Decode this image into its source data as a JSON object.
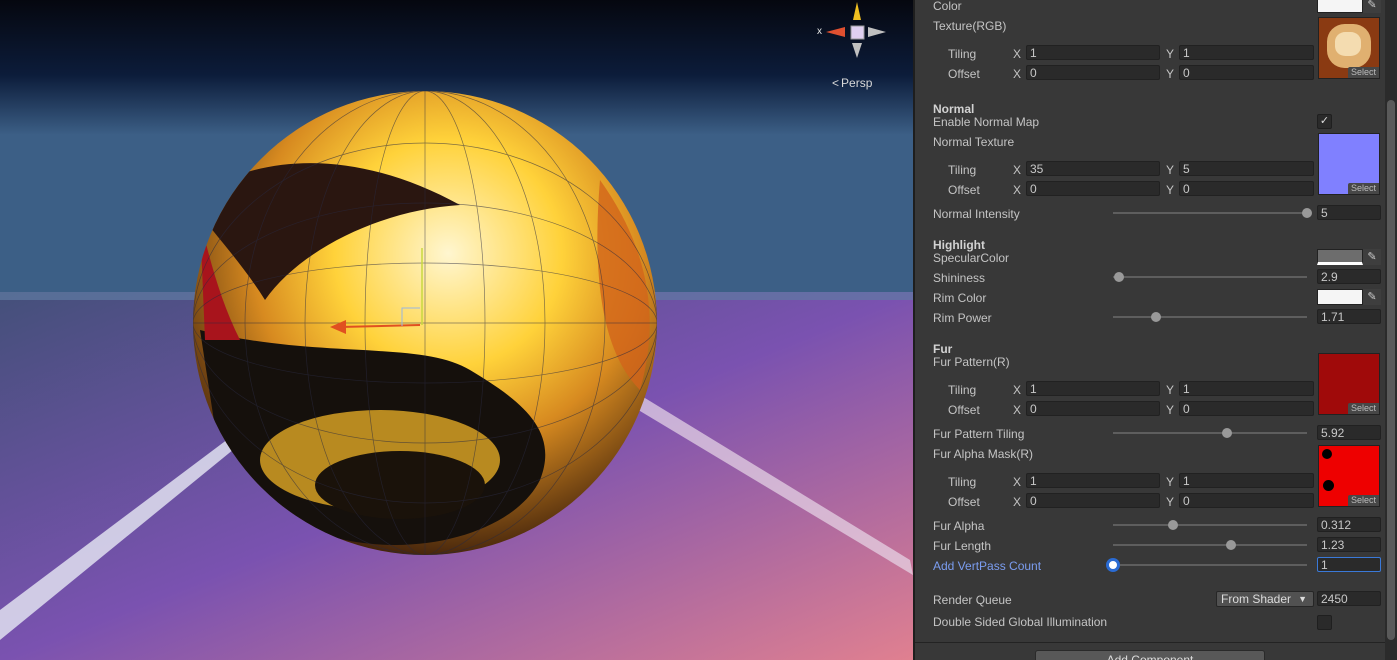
{
  "scene": {
    "persp_label": "Persp",
    "axis_x_label": "x"
  },
  "inspector": {
    "color_label": "Color",
    "color_value": "#f5f5f5",
    "texture": {
      "label": "Texture(RGB)",
      "select": "Select",
      "tiling_label": "Tiling",
      "offset_label": "Offset",
      "tiling_x": "1",
      "tiling_y": "1",
      "offset_x": "0",
      "offset_y": "0"
    },
    "normal": {
      "header": "Normal",
      "enable_label": "Enable Normal Map",
      "enable_checked": "✓",
      "texture_label": "Normal Texture",
      "select": "Select",
      "tiling_label": "Tiling",
      "offset_label": "Offset",
      "tiling_x": "35",
      "tiling_y": "5",
      "offset_x": "0",
      "offset_y": "0",
      "intensity_label": "Normal Intensity",
      "intensity_value": "5",
      "intensity_fraction": 1.0
    },
    "highlight": {
      "header": "Highlight",
      "specular_label": "SpecularColor",
      "specular_color": "#6d6d6d",
      "shininess_label": "Shininess",
      "shininess_value": "2.9",
      "shininess_fraction": 0.03,
      "rim_color_label": "Rim Color",
      "rim_color": "#f5f5f5",
      "rim_power_label": "Rim Power",
      "rim_power_value": "1.71",
      "rim_power_fraction": 0.22
    },
    "fur": {
      "header": "Fur",
      "pattern_label": "Fur Pattern(R)",
      "select": "Select",
      "pattern_tiling_x": "1",
      "pattern_tiling_y": "1",
      "pattern_offset_x": "0",
      "pattern_offset_y": "0",
      "tiling_label": "Tiling",
      "offset_label": "Offset",
      "pattern_tiling_label": "Fur Pattern Tiling",
      "pattern_tiling_value": "5.92",
      "pattern_tiling_fraction": 0.59,
      "alpha_mask_label": "Fur Alpha Mask(R)",
      "mask_tiling_x": "1",
      "mask_tiling_y": "1",
      "mask_offset_x": "0",
      "mask_offset_y": "0",
      "alpha_label": "Fur Alpha",
      "alpha_value": "0.312",
      "alpha_fraction": 0.31,
      "length_label": "Fur Length",
      "length_value": "1.23",
      "length_fraction": 0.61,
      "vertpass_label": "Add VertPass Count",
      "vertpass_value": "1",
      "vertpass_fraction": 0.0
    },
    "render_queue_label": "Render Queue",
    "render_queue_mode": "From Shader",
    "render_queue_value": "2450",
    "dsgi_label": "Double Sided Global Illumination",
    "add_component": "Add Component"
  }
}
